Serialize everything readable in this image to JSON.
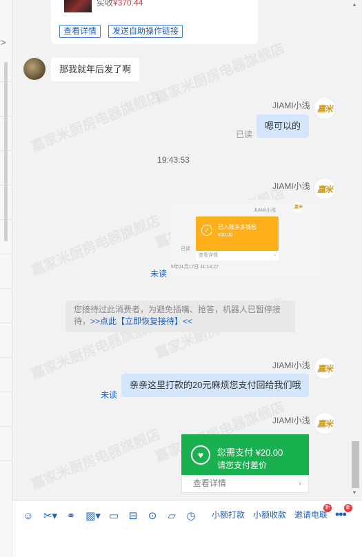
{
  "product_card": {
    "price_label": "实收",
    "price_value": "¥370.44",
    "view_details": "查看详情",
    "send_link": "发送自助操作链接"
  },
  "messages": {
    "customer_msg": "那我就年后发了啊",
    "agent_name": "JIAMI小浅",
    "agent_logo": "嘉米",
    "reply_1": "嗯可以的",
    "read": "已读",
    "unread": "未读",
    "timestamp": "19:43:53",
    "reply_2": "亲亲这里打款的20元麻烦您支付回给我们哦"
  },
  "image_message": {
    "mini_name": "JIAMI小浅",
    "card_title": "已入账多多钱包",
    "card_amount": "¥20.00",
    "card_link": "查看详情",
    "mini_read": "已读",
    "mini_time": "25年01月17日 11:14:27"
  },
  "system_notice": {
    "text": "您接待过此消费者，为避免插嘴、抢答，机器人已暂停接待，",
    "link": ">>点此【立即恢复接待】<<"
  },
  "payment_card": {
    "title": "您需支付 ¥20.00",
    "subtitle": "请您支付差价",
    "details": "查看详情"
  },
  "toolbar": {
    "small_transfer": "小额打款",
    "small_collect": "小额收款",
    "invite_review": "邀请电联",
    "badge_new": "新"
  },
  "watermark_text": "嘉家米厨房电器旗舰店",
  "colors": {
    "accent": "#1f5fbf",
    "pay_green": "#19b04f",
    "wallet_orange": "#fdb01c",
    "price_red": "#e4393c"
  }
}
